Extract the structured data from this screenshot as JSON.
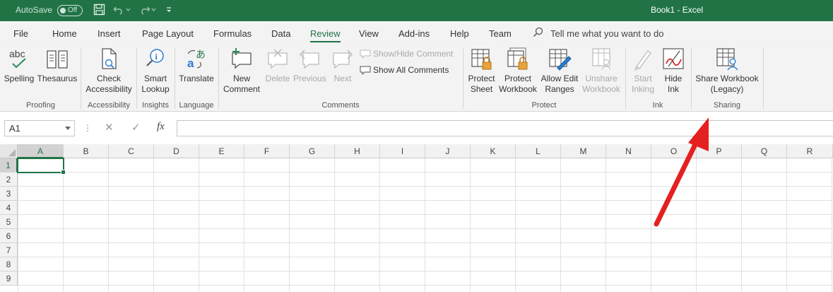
{
  "titlebar": {
    "autosave_label": "AutoSave",
    "autosave_state": "Off",
    "title": "Book1  -  Excel",
    "accent_color": "#217346"
  },
  "tabs": [
    {
      "label": "File"
    },
    {
      "label": "Home"
    },
    {
      "label": "Insert"
    },
    {
      "label": "Page Layout"
    },
    {
      "label": "Formulas"
    },
    {
      "label": "Data"
    },
    {
      "label": "Review",
      "active": true
    },
    {
      "label": "View"
    },
    {
      "label": "Add-ins"
    },
    {
      "label": "Help"
    },
    {
      "label": "Team"
    }
  ],
  "tell_me": "Tell me what you want to do",
  "ribbon": {
    "spelling": "Spelling",
    "thesaurus": "Thesaurus",
    "check_l1": "Check",
    "check_l2": "Accessibility",
    "smart_l1": "Smart",
    "smart_l2": "Lookup",
    "translate": "Translate",
    "new_l1": "New",
    "new_l2": "Comment",
    "delete": "Delete",
    "previous": "Previous",
    "next": "Next",
    "show_hide_comment": "Show/Hide Comment",
    "show_all_comments": "Show All Comments",
    "protect_sheet_l1": "Protect",
    "protect_sheet_l2": "Sheet",
    "protect_wb_l1": "Protect",
    "protect_wb_l2": "Workbook",
    "allow_edit_l1": "Allow Edit",
    "allow_edit_l2": "Ranges",
    "unshare_l1": "Unshare",
    "unshare_l2": "Workbook",
    "start_ink_l1": "Start",
    "start_ink_l2": "Inking",
    "hide_ink_l1": "Hide",
    "hide_ink_l2": "Ink",
    "share_l1": "Share Workbook",
    "share_l2": "(Legacy)",
    "groups": {
      "proofing": "Proofing",
      "accessibility": "Accessibility",
      "insights": "Insights",
      "language": "Language",
      "comments": "Comments",
      "protect": "Protect",
      "ink": "Ink",
      "sharing": "Sharing"
    }
  },
  "formula_bar": {
    "name_box": "A1",
    "fx": "fx",
    "cancel": "✕",
    "enter": "✓",
    "dots": "⋮",
    "value": ""
  },
  "grid": {
    "columns": [
      "A",
      "B",
      "C",
      "D",
      "E",
      "F",
      "G",
      "H",
      "I",
      "J",
      "K",
      "L",
      "M",
      "N",
      "O",
      "P",
      "Q",
      "R"
    ],
    "rows": [
      "1",
      "2",
      "3",
      "4",
      "5",
      "6",
      "7",
      "8",
      "9"
    ],
    "active_cell": "A1"
  },
  "annotation": {
    "arrow_color": "#e52020"
  }
}
